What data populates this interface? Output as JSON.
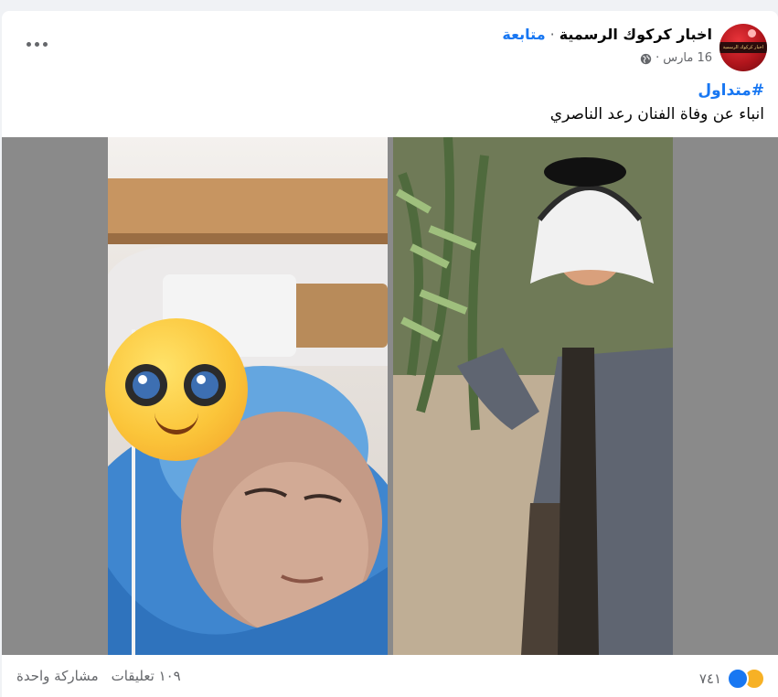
{
  "header": {
    "page_name": "اخبار كركوك الرسمية",
    "separator": "·",
    "follow_label": "متابعة",
    "date": "16 مارس",
    "meta_separator": "·",
    "globe_icon": "globe-icon",
    "more_icon": "more-options-icon",
    "avatar_text": "اخبار كركوك الرسمية"
  },
  "post": {
    "hashtag": "#متداول",
    "text": "انباء عن وفاة الفنان رعد الناصري"
  },
  "media": {
    "left_photo_icon": "pleading-face-emoji"
  },
  "footer": {
    "reaction_count": "٧٤١",
    "reaction_icons": [
      "like-icon",
      "sad-icon"
    ],
    "comments": "١٠٩ تعليقات",
    "shares": "مشاركة واحدة"
  },
  "colors": {
    "accent": "#1877f2",
    "text": "#050505",
    "muted": "#65676b",
    "background": "#f0f2f5"
  }
}
